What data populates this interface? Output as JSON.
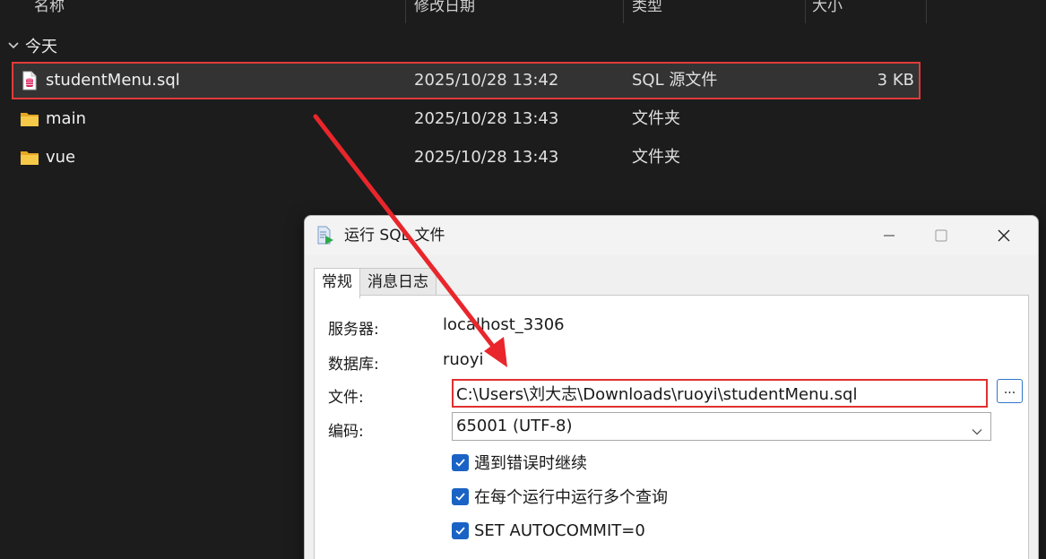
{
  "explorer": {
    "columns": {
      "name": "名称",
      "modified": "修改日期",
      "type": "类型",
      "size": "大小"
    },
    "group": {
      "label": "今天"
    },
    "files": [
      {
        "name": "studentMenu.sql",
        "modified": "2025/10/28 13:42",
        "type": "SQL 源文件",
        "size": "3 KB",
        "icon": "sql-file-icon"
      },
      {
        "name": "main",
        "modified": "2025/10/28 13:43",
        "type": "文件夹",
        "size": "",
        "icon": "folder-icon"
      },
      {
        "name": "vue",
        "modified": "2025/10/28 13:43",
        "type": "文件夹",
        "size": "",
        "icon": "folder-icon"
      }
    ]
  },
  "dialog": {
    "title": "运行 SQL 文件",
    "tabs": [
      "常规",
      "消息日志"
    ],
    "active_tab": 0,
    "server_label": "服务器:",
    "server_value": "localhost_3306",
    "database_label": "数据库:",
    "database_value": "ruoyi",
    "file_label": "文件:",
    "file_value": "C:\\Users\\刘大志\\Downloads\\ruoyi\\studentMenu.sql",
    "browse_label": "...",
    "encoding_label": "编码:",
    "encoding_value": "65001 (UTF-8)",
    "options": [
      {
        "label": "遇到错误时继续",
        "checked": true
      },
      {
        "label": "在每个运行中运行多个查询",
        "checked": true
      },
      {
        "label": "SET AUTOCOMMIT=0",
        "checked": true
      }
    ]
  },
  "colors": {
    "highlight_red": "#e23a3a",
    "checkbox_blue": "#1a63c5",
    "explorer_bg": "#1c1c1c",
    "folder_yellow": "#f7c948"
  }
}
